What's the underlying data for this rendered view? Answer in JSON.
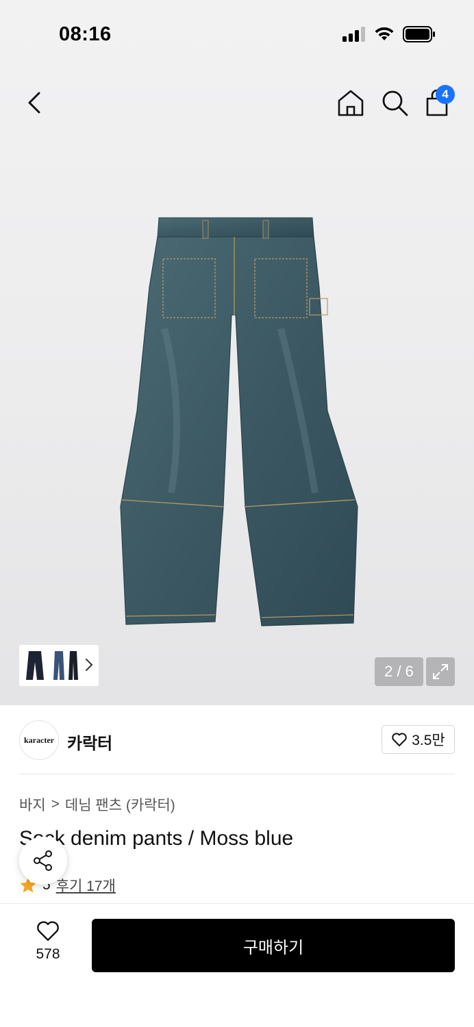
{
  "status_bar": {
    "time": "08:16"
  },
  "nav": {
    "cart_count": "4"
  },
  "gallery": {
    "page_indicator": "2 / 6"
  },
  "brand": {
    "logo_text": "karacter",
    "name": "카락터",
    "like_count": "3.5만"
  },
  "breadcrumb": {
    "category": "바지",
    "separator": ">",
    "subcategory": "데님 팬츠 (카락터)"
  },
  "product": {
    "title": "Sock denim pants / Moss blue",
    "rating": "5",
    "review_link": "후기 17개"
  },
  "bottom_bar": {
    "wish_count": "578",
    "buy_label": "구매하기"
  },
  "colors": {
    "badge": "#1a73ff",
    "buy_button": "#000000",
    "denim": "#3c5963"
  },
  "icons": [
    "back-icon",
    "home-icon",
    "search-icon",
    "bag-icon",
    "chevron-right-icon",
    "expand-icon",
    "heart-icon",
    "share-icon",
    "star-icon",
    "signal-icon",
    "wifi-icon",
    "battery-icon"
  ]
}
